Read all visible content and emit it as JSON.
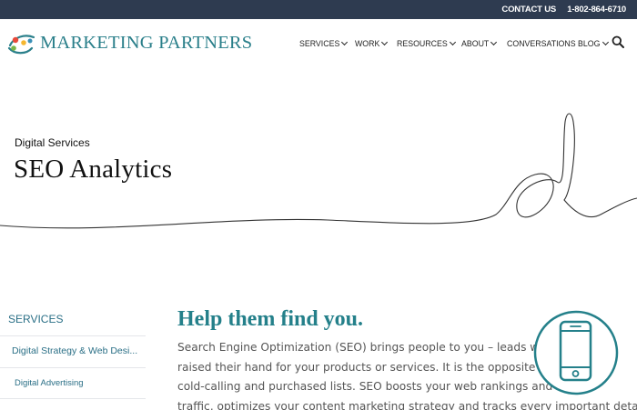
{
  "topbar": {
    "contact_label": "CONTACT US",
    "phone": "1-802-864-6710"
  },
  "header": {
    "logo_text": "MARKETING PARTNERS",
    "nav": [
      {
        "label": "SERVICES"
      },
      {
        "label": "WORK"
      },
      {
        "label": "RESOURCES"
      },
      {
        "label": "ABOUT"
      },
      {
        "label": "CONVERSATIONS BLOG"
      }
    ],
    "search_icon": "search-icon"
  },
  "hero": {
    "subtitle": "Digital Services",
    "title": "SEO Analytics"
  },
  "sidebar": {
    "title": "SERVICES",
    "items": [
      {
        "label": "Digital Strategy & Web Desi..."
      },
      {
        "label": "Digital Advertising"
      }
    ]
  },
  "main": {
    "heading": "Help them find you.",
    "paragraph_lines": [
      "Search Engine Optimization (SEO) brings people to you – leads who",
      "raised their hand for your products or services. It is the opposite of",
      "cold-calling and purchased lists. SEO boosts your web rankings and",
      "traffic, optimizes your content marketing strategy and tracks every important detail."
    ],
    "badge_icon": "mobile-phone-icon"
  },
  "colors": {
    "topbar_bg": "#2e3b50",
    "brand_teal": "#24808a",
    "sidebar_link": "#2a6f86"
  }
}
